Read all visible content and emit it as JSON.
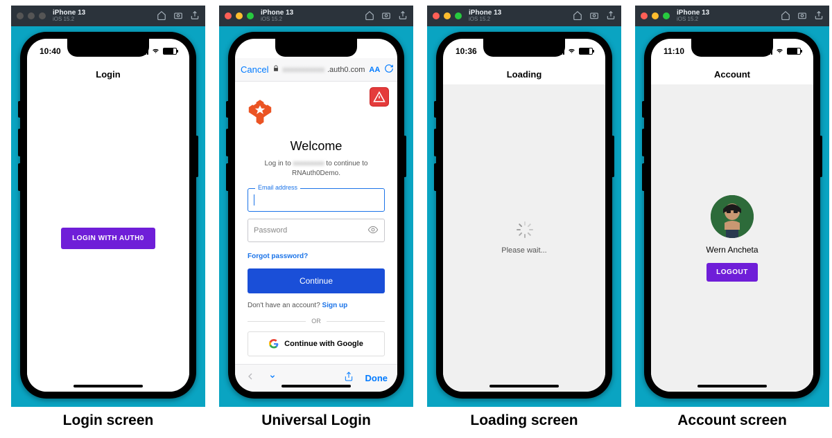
{
  "simulator": {
    "device": "iPhone 13",
    "os": "iOS 15.2"
  },
  "captions": {
    "c1": "Login screen",
    "c2": "Universal Login",
    "c3": "Loading screen",
    "c4": "Account screen"
  },
  "s1": {
    "time": "10:40",
    "header": "Login",
    "button": "LOGIN WITH AUTH0"
  },
  "s2": {
    "cancel": "Cancel",
    "url_suffix": ".auth0.com",
    "aa": "AA",
    "title": "Welcome",
    "sub_prefix": "Log in to ",
    "sub_suffix": " to continue to",
    "app_name": "RNAuth0Demo.",
    "email_label": "Email address",
    "password_ph": "Password",
    "forgot": "Forgot password?",
    "continue": "Continue",
    "signup_q": "Don't have an account?  ",
    "signup": "Sign up",
    "or": "OR",
    "google": "Continue with Google",
    "done": "Done"
  },
  "s3": {
    "time": "10:36",
    "header": "Loading",
    "please": "Please wait..."
  },
  "s4": {
    "time": "11:10",
    "header": "Account",
    "name": "Wern Ancheta",
    "logout": "LOGOUT"
  }
}
